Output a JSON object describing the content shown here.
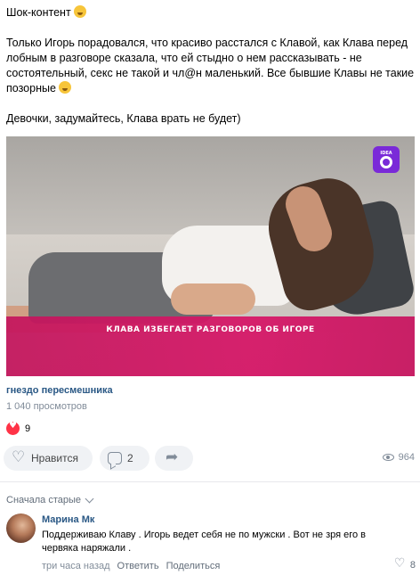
{
  "post": {
    "line1": "Шок-контент",
    "line1_emoji": "emoji-sweat-smile",
    "paragraph": "Только Игорь порадовался, что красиво расстался с Клавой, как Клава перед лобным в разговоре сказала, что ей стыдно о нем рассказывать - не состоятельный, секс не такой и чл@н маленький. Все бывшие Клавы не такие позорные",
    "paragraph_emoji": "emoji-grin",
    "closing": "Девочки, задумайтесь, Клава врать не будет)"
  },
  "video": {
    "caption": "КЛАВА ИЗБЕГАЕТ РАЗГОВОРОВ ОБ ИГОРЕ",
    "logo_text": "IDEA",
    "caption_color": "#d61868"
  },
  "source": {
    "name": "гнездо пересмешника",
    "views": "1 040 просмотров"
  },
  "reactions": {
    "icon": "heart-icon",
    "count": "9",
    "color": "#ff3347"
  },
  "actions": {
    "like_label": "Нравится",
    "comment_count": "2",
    "views_count": "964"
  },
  "comments": {
    "sort_label": "Сначала старые",
    "items": [
      {
        "author": "Марина Мк",
        "text": "Поддерживаю Клаву . Игорь ведет себя не по мужски . Вот не зря его в червяка наряжали .",
        "time": "три часа назад",
        "reply": "Ответить",
        "share": "Поделиться",
        "likes": "8"
      }
    ]
  },
  "colors": {
    "link": "#2a5885",
    "secondary": "#818c99",
    "button_bg": "#f0f2f5"
  }
}
